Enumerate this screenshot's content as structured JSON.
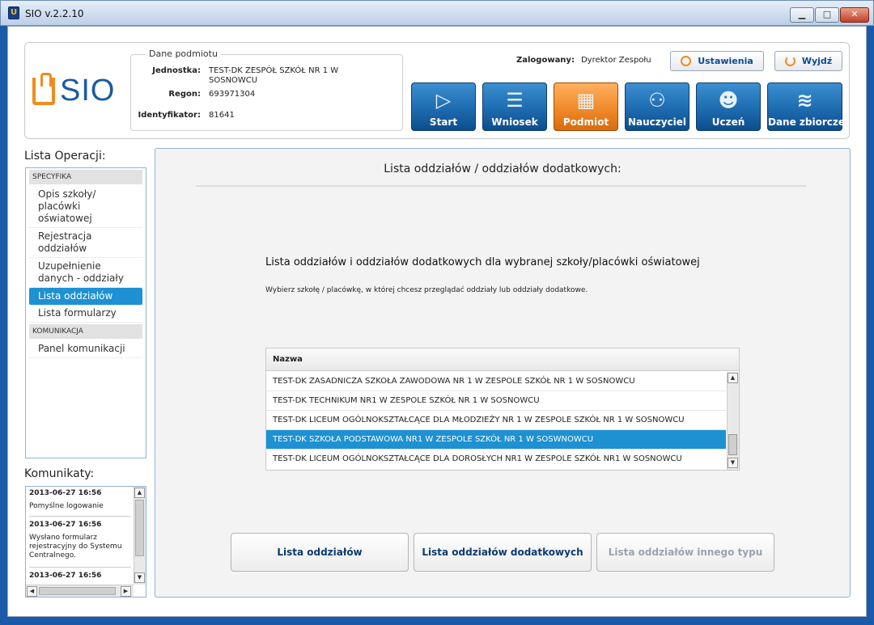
{
  "window": {
    "title": "SIO v.2.2.10",
    "icon": "app-logo-icon"
  },
  "header": {
    "logo_text": "SIO",
    "entity": {
      "legend": "Dane podmiotu",
      "unit_label": "Jednostka:",
      "unit_value_line1": "TEST-DK ZESPÓŁ SZKÓŁ NR 1 W",
      "unit_value_line2": "SOSNOWCU",
      "regon_label": "Regon:",
      "regon_value": "693971304",
      "id_label": "Identyfikator:",
      "id_value": "81641"
    },
    "logged_label": "Zalogowany:",
    "logged_user": "Dyrektor Zespołu",
    "settings_label": "Ustawienia",
    "exit_label": "Wyjdź",
    "nav": [
      {
        "label": "Start",
        "icon": "play-icon"
      },
      {
        "label": "Wniosek",
        "icon": "database-icon"
      },
      {
        "label": "Podmiot",
        "icon": "building-icon"
      },
      {
        "label": "Nauczyciel",
        "icon": "teacher-icon"
      },
      {
        "label": "Uczeń",
        "icon": "student-icon"
      },
      {
        "label": "Dane zbiorcze",
        "icon": "books-icon"
      }
    ],
    "active_nav": "Podmiot"
  },
  "sidebar": {
    "title": "Lista Operacji:",
    "sections": [
      {
        "name": "SPECYFIKA",
        "items": [
          "Opis szkoły/ placówki oświatowej",
          "Rejestracja oddziałów",
          "Uzupełnienie danych - oddziały",
          "Lista oddziałów",
          "Lista formularzy"
        ]
      },
      {
        "name": "KOMUNIKACJA",
        "items": [
          "Panel komunikacji"
        ]
      }
    ],
    "selected_item": "Lista oddziałów"
  },
  "messages": {
    "title": "Komunikaty:",
    "items": [
      {
        "date": "2013-06-27 16:56",
        "text": "Pomyślne logowanie"
      },
      {
        "date": "2013-06-27 16:56",
        "text": "Wysłano formularz rejestracyjny do Systemu Centralnego."
      },
      {
        "date": "2013-06-27 16:56",
        "text": ""
      }
    ]
  },
  "main": {
    "heading": "Lista oddziałów / oddziałów dodatkowych:",
    "subheading": "Lista oddziałów i oddziałów dodatkowych dla wybranej szkoły/placówki oświatowej",
    "hint": "Wybierz szkołę / placówkę, w której chcesz przeglądać oddziały lub oddziały dodatkowe.",
    "table": {
      "column": "Nazwa",
      "rows": [
        "TEST-DK ZASADNICZA SZKOŁA ZAWODOWA NR 1 W ZESPOLE SZKÓŁ NR 1 W SOSNOWCU",
        "TEST-DK TECHNIKUM NR1 W ZESPOLE SZKÓŁ NR 1 W SOSNOWCU",
        "TEST-DK LICEUM OGÓLNOKSZTAŁCĄCE DLA MŁODZIEŻY NR 1 W ZESPOLE SZKÓŁ NR 1 W SOSNOWCU",
        "TEST-DK SZKOŁA PODSTAWOWA NR1 W ZESPOLE SZKÓŁ NR 1 W SOSWNOWCU",
        "TEST-DK LICEUM OGÓLNOKSZTAŁCĄCE DLA DOROSŁYCH NR1 W ZESPOLE SZKÓŁ NR1 W SOSNOWCU"
      ],
      "selected_row": 3
    },
    "buttons": {
      "list": "Lista oddziałów",
      "extra": "Lista oddziałów dodatkowych",
      "other": "Lista oddziałów innego typu"
    }
  },
  "colors": {
    "accent": "#1d91d2",
    "brand_blue": "#1d5aa0",
    "brand_orange": "#f08c1e",
    "nav_blue": "#1e6bb0",
    "nav_active": "#f08a2a"
  }
}
